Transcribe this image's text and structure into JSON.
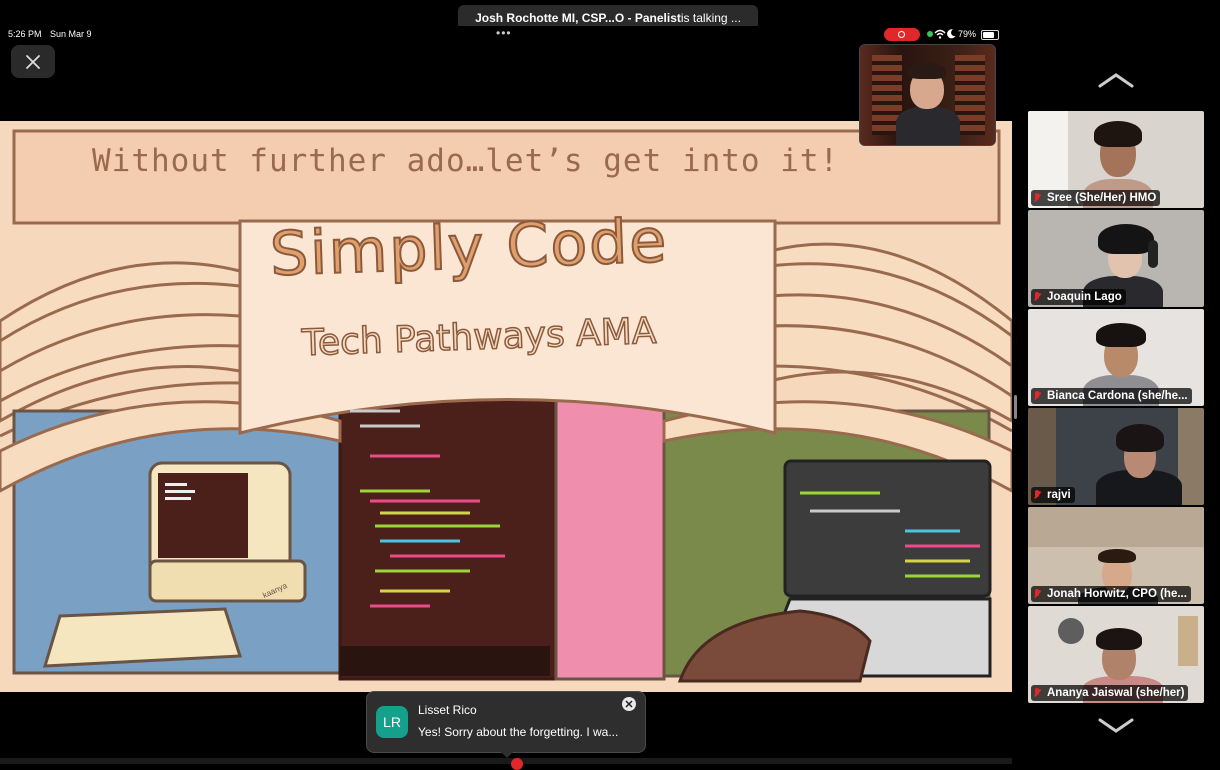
{
  "banner": {
    "speaker": "Josh Rochotte MI, CSP...O - Panelist",
    "suffix": " is talking ..."
  },
  "status": {
    "time": "5:26 PM",
    "date": "Sun Mar 9",
    "battery": "79%"
  },
  "slide": {
    "headline": "Without further ado…let’s get into it!",
    "title": "Simply Code",
    "subtitle": "Tech Pathways AMA",
    "signature": "kaanya"
  },
  "participants": [
    {
      "name": "Sree (She/Her) HMO"
    },
    {
      "name": "Joaquin Lago"
    },
    {
      "name": "Bianca Cardona (she/he..."
    },
    {
      "name": "rajvi"
    },
    {
      "name": "Jonah Horwitz, CPO (he..."
    },
    {
      "name": "Ananya Jaiswal (she/her)"
    }
  ],
  "toast": {
    "initials": "LR",
    "sender": "Lisset Rico",
    "message": "Yes! Sorry about the forgetting. I wa..."
  },
  "colors": {
    "recording": "#e0282a",
    "avatar": "#14a08a",
    "slide_bg": "#f6d9bd",
    "slide_ink": "#9a6a4e"
  },
  "icons": [
    "close-icon",
    "record-icon",
    "wifi-icon",
    "moon-icon",
    "battery-icon",
    "mic-muted-icon",
    "chevron-up-icon",
    "chevron-down-icon"
  ]
}
